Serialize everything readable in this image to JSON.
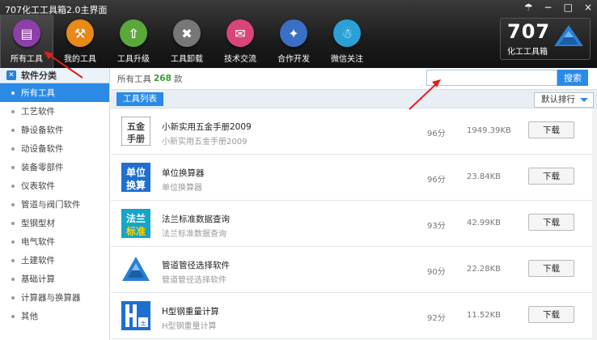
{
  "window": {
    "title": "707化工工具箱2.0主界面",
    "controls": [
      "☂",
      "−",
      "□",
      "×"
    ]
  },
  "toolbar": [
    {
      "label": "所有工具",
      "icon": "toolbox-icon",
      "color": "#8e3fa8",
      "glyph": "▤"
    },
    {
      "label": "我的工具",
      "icon": "wrench-icon",
      "color": "#e88a1a",
      "glyph": "⚒"
    },
    {
      "label": "工具升级",
      "icon": "upload-icon",
      "color": "#5aa83a",
      "glyph": "⇧"
    },
    {
      "label": "工具卸载",
      "icon": "trash-icon",
      "color": "#777777",
      "glyph": "✖"
    },
    {
      "label": "技术交流",
      "icon": "folder-icon",
      "color": "#d8457a",
      "glyph": "✉"
    },
    {
      "label": "合作开发",
      "icon": "handshake-icon",
      "color": "#3a6fc4",
      "glyph": "✦"
    },
    {
      "label": "微信关注",
      "icon": "wechat-icon",
      "color": "#2aa0d8",
      "glyph": "☃"
    }
  ],
  "brand": {
    "number": "707",
    "text": "化工工具箱"
  },
  "sidebar": {
    "title": "软件分类",
    "items": [
      "所有工具",
      "工艺软件",
      "静设备软件",
      "动设备软件",
      "装备零部件",
      "仪表软件",
      "管道与阀门软件",
      "型钢型材",
      "电气软件",
      "土建软件",
      "基础计算",
      "计算器与换算器",
      "其他"
    ]
  },
  "count": {
    "prefix": "所有工具",
    "value": "268",
    "suffix": "款"
  },
  "search": {
    "placeholder": "",
    "button": "搜索"
  },
  "list_tab": "工具列表",
  "sort": "默认排行",
  "download_label": "下载",
  "tools": [
    {
      "name": "小新实用五金手册2009",
      "desc": "小新实用五金手册2009",
      "score": "96分",
      "size": "1949.39KB",
      "logo": "hardware-manual-icon",
      "logo_text": "五金\n手册"
    },
    {
      "name": "单位换算器",
      "desc": "单位换算器",
      "score": "96分",
      "size": "23.84KB",
      "logo": "unit-converter-icon",
      "logo_text": "单位\n换算"
    },
    {
      "name": "法兰标准数据查询",
      "desc": "法兰标准数据查询",
      "score": "93分",
      "size": "42.99KB",
      "logo": "flange-standard-icon",
      "logo_text": "法兰\n标准"
    },
    {
      "name": "管道管径选择软件",
      "desc": "管道管径选择软件",
      "score": "90分",
      "size": "22.28KB",
      "logo": "pipe-diameter-icon",
      "logo_text": ""
    },
    {
      "name": "H型钢重量计算",
      "desc": "H型钢重量计算",
      "score": "92分",
      "size": "11.52KB",
      "logo": "h-beam-icon",
      "logo_text": ""
    }
  ],
  "colors": {
    "accent": "#2a8ae6",
    "count_green": "#3a9a3a",
    "annotation_red": "#e02020"
  }
}
